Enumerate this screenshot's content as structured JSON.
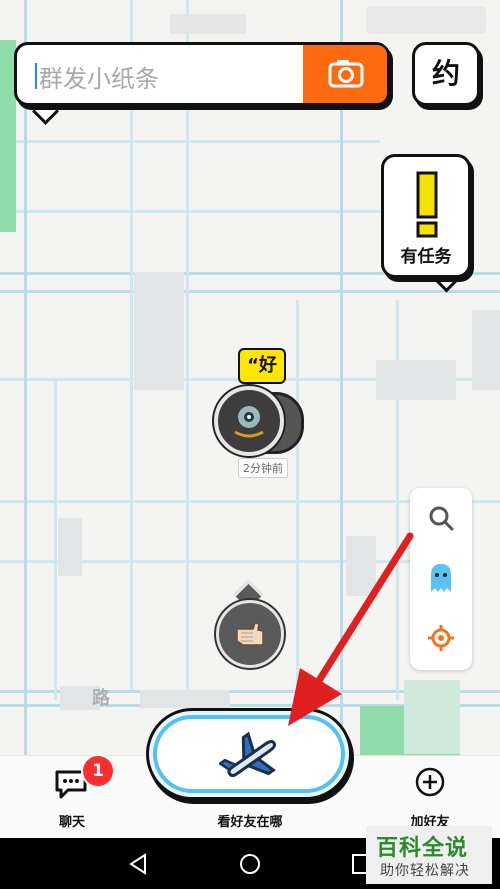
{
  "search": {
    "placeholder": "群发小纸条",
    "camera_icon": "camera-icon",
    "accent": "#ff6a10"
  },
  "yue_button": {
    "label": "约"
  },
  "task_card": {
    "label": "有任务",
    "icon": "exclamation-icon",
    "color": "#f4e200"
  },
  "map": {
    "road_label": "路",
    "friend_marker": {
      "bubble_text": "“好",
      "time": "2分钟前"
    }
  },
  "tools": [
    "search-icon",
    "ghost-icon",
    "locate-icon"
  ],
  "bottom_nav": {
    "chat": {
      "label": "聊天",
      "badge": "1"
    },
    "center": {
      "label": "看好友在哪"
    },
    "add_friend": {
      "label": "加好友"
    }
  },
  "watermark": {
    "title": "百科全说",
    "subtitle": "助你轻松解决"
  },
  "colors": {
    "brand_blue": "#56c0f0",
    "badge_red": "#ff2d2d",
    "arrow_red": "#e02020"
  }
}
